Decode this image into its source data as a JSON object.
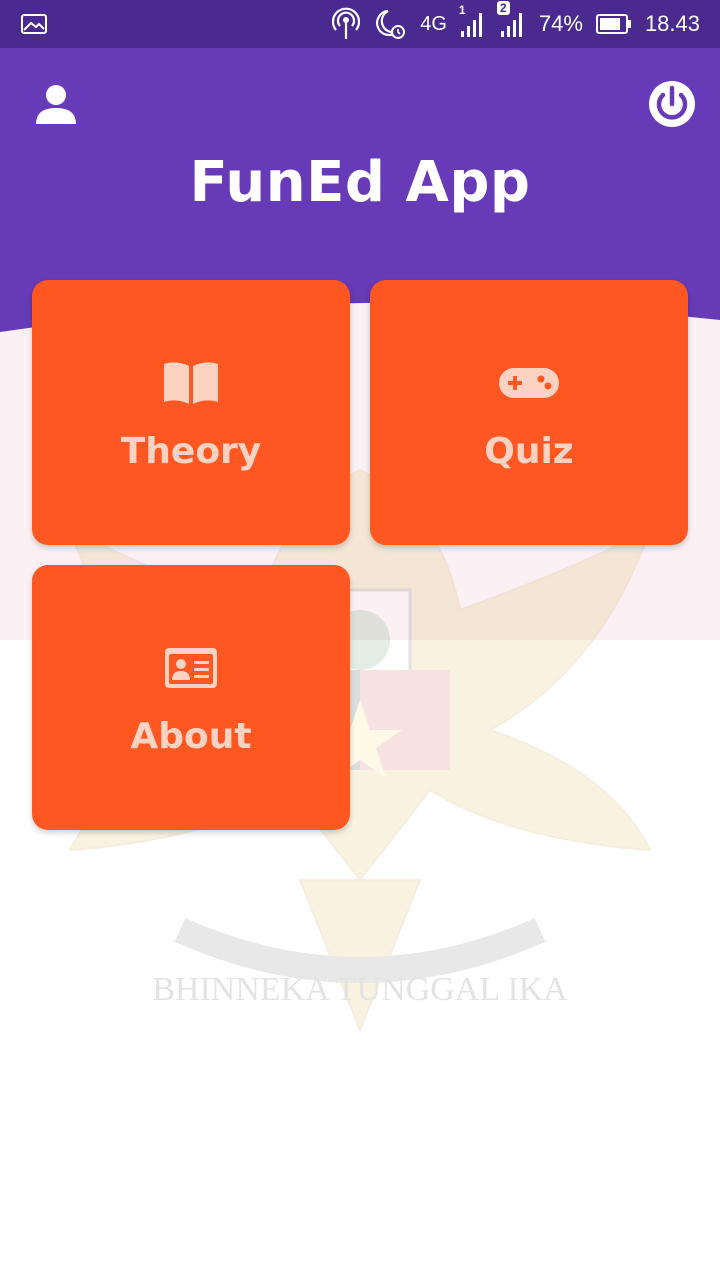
{
  "status_bar": {
    "network": "4G",
    "sim1_badge": "1",
    "sim2_badge": "2",
    "battery": "74%",
    "time": "18.43",
    "icons": [
      "image-icon",
      "hotspot-icon",
      "moon-alarm-icon",
      "signal-icon",
      "signal-icon",
      "battery-icon"
    ]
  },
  "header": {
    "title": "FunEd App",
    "left_icon": "profile-icon",
    "right_icon": "power-icon"
  },
  "menu": {
    "items": [
      {
        "label": "Theory",
        "icon": "book-icon"
      },
      {
        "label": "Quiz",
        "icon": "gamepad-icon"
      },
      {
        "label": "About",
        "icon": "id-card-icon"
      }
    ]
  },
  "background": {
    "emblem_motto": "BHINNEKA TUNGGAL IKA"
  },
  "colors": {
    "status_bar": "#4a2a8f",
    "header": "#673ab7",
    "card": "#ff5722",
    "card_text": "#fcd2c3"
  }
}
